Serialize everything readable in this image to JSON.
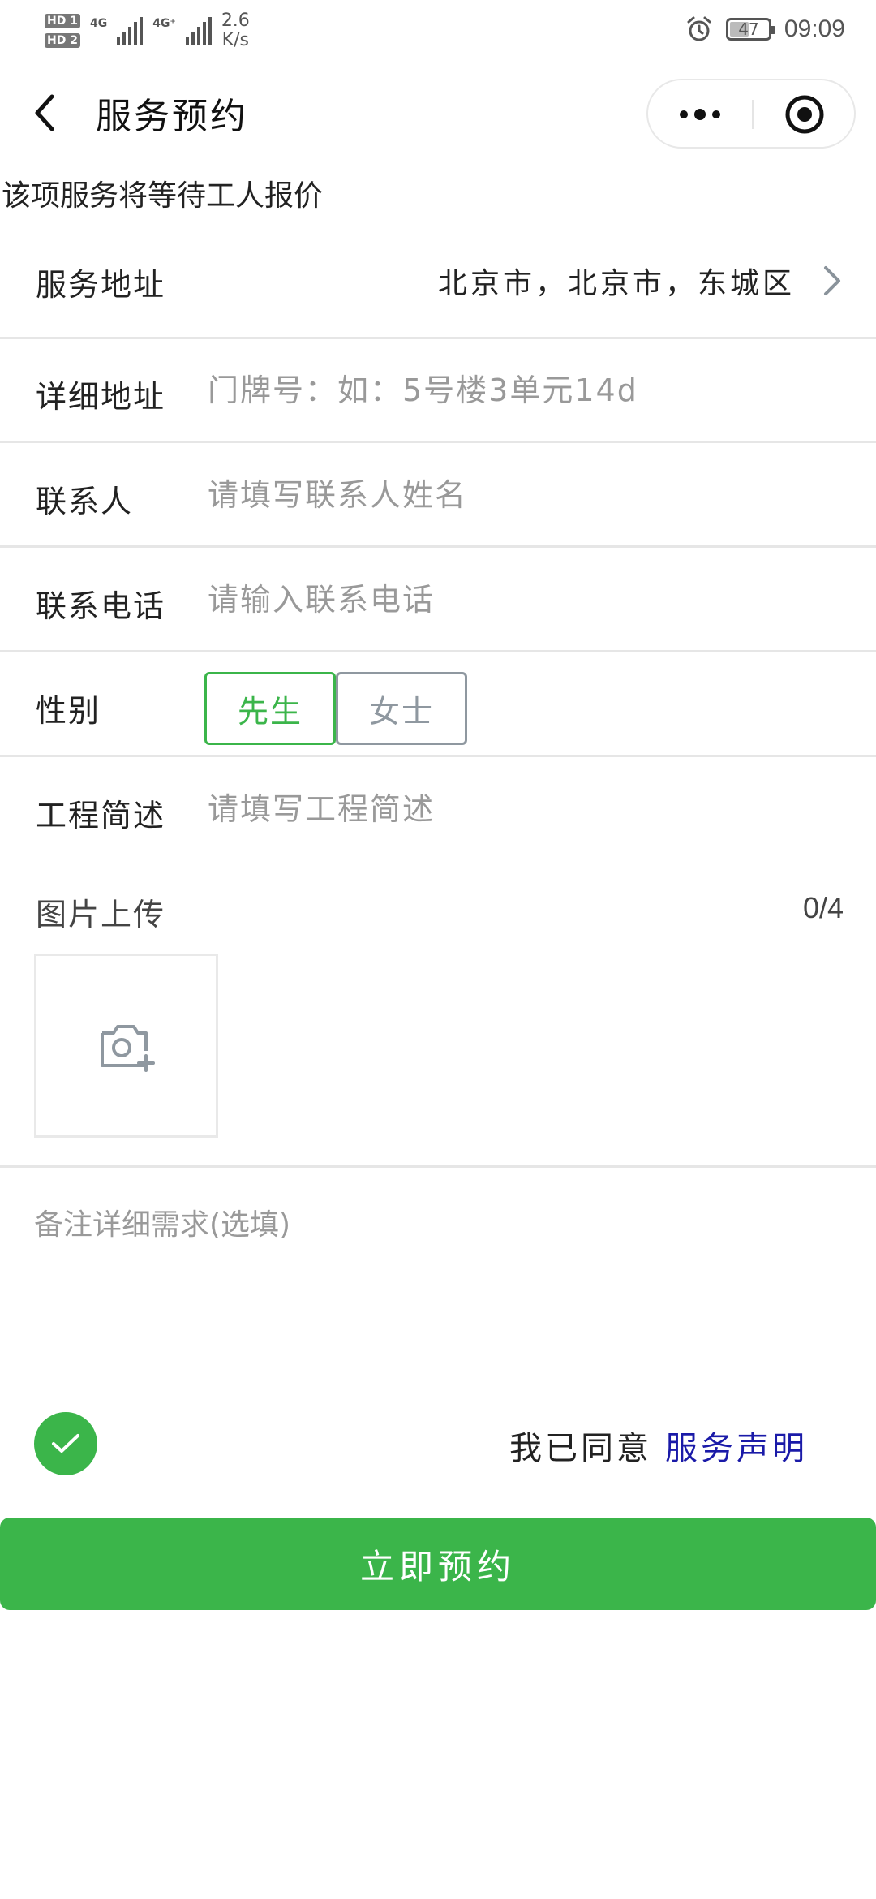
{
  "status_bar": {
    "hd1": "HD 1",
    "hd2": "HD 2",
    "net1": "4G",
    "net2": "4G⁺",
    "speed_value": "2.6",
    "speed_unit": "K/s",
    "battery": "47",
    "time": "09:09",
    "icons": [
      "alarm-icon",
      "battery-icon"
    ]
  },
  "nav": {
    "back_icon": "chevron-left-icon",
    "title": "服务预约",
    "more_icon": "more-dots-icon",
    "close_icon": "target-icon"
  },
  "notice": "该项服务将等待工人报价",
  "form": {
    "service_address": {
      "label": "服务地址",
      "value": "北京市，北京市，东城区"
    },
    "detail_address": {
      "label": "详细地址",
      "placeholder": "门牌号：如：5号楼3单元14d"
    },
    "contact": {
      "label": "联系人",
      "placeholder": "请填写联系人姓名"
    },
    "phone": {
      "label": "联系电话",
      "placeholder": "请输入联系电话"
    },
    "gender": {
      "label": "性别",
      "options": [
        "先生",
        "女士"
      ],
      "selected": "先生"
    },
    "project": {
      "label": "工程简述",
      "placeholder": "请填写工程简述"
    },
    "upload": {
      "label": "图片上传",
      "count": "0/4",
      "icon": "camera-add-icon"
    },
    "remark": {
      "placeholder": "备注详细需求(选填)"
    }
  },
  "agreement": {
    "checked": true,
    "text": "我已同意",
    "link": "服务声明"
  },
  "submit": {
    "label": "立即预约"
  },
  "colors": {
    "accent": "#3bb54a",
    "link": "#1a1aa8",
    "divider": "#e6e6e6",
    "placeholder": "#999999"
  }
}
